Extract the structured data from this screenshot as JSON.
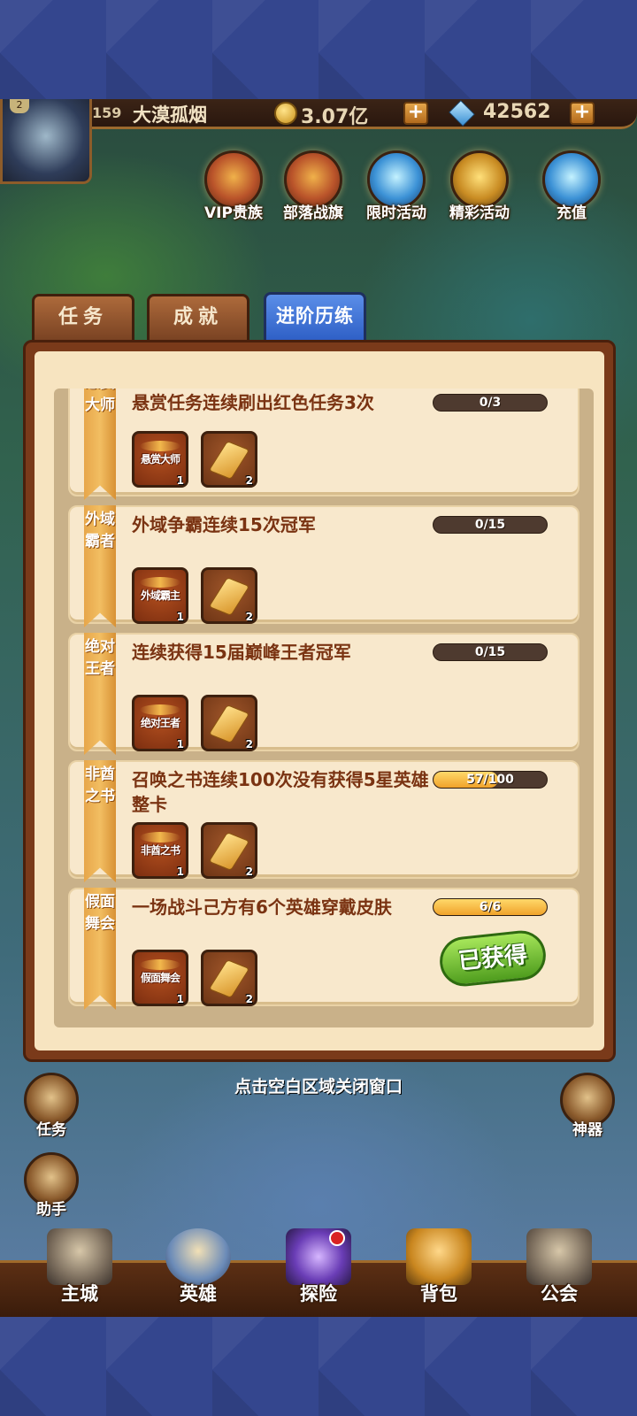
{
  "player": {
    "level": "159",
    "avatar_level": "2",
    "name": "大漠孤烟",
    "gold": "3.07亿",
    "gems": "42562"
  },
  "top_features": [
    {
      "label": "VIP贵族",
      "icon": "crown-icon"
    },
    {
      "label": "部落战旗",
      "icon": "banner-icon"
    },
    {
      "label": "限时活动",
      "icon": "compass-icon"
    },
    {
      "label": "精彩活动",
      "icon": "chest-icon"
    },
    {
      "label": "充值",
      "icon": "diamond-icon"
    }
  ],
  "tabs": [
    {
      "label": "任务",
      "active": false
    },
    {
      "label": "成就",
      "active": false
    },
    {
      "label": "进阶历练",
      "active": true
    }
  ],
  "tasks": [
    {
      "ribbon": "悬赏大师",
      "title": "悬赏任务连续刷出红色任务3次",
      "progress_text": "0/3",
      "progress": 0,
      "badge": "悬赏大师",
      "badge_count": "1",
      "scroll_count": "2",
      "obtained": false
    },
    {
      "ribbon": "外域霸者",
      "title": "外域争霸连续15次冠军",
      "progress_text": "0/15",
      "progress": 0,
      "badge": "外域霸主",
      "badge_count": "1",
      "scroll_count": "2",
      "obtained": false
    },
    {
      "ribbon": "绝对王者",
      "title": "连续获得15届巅峰王者冠军",
      "progress_text": "0/15",
      "progress": 0,
      "badge": "绝对王者",
      "badge_count": "1",
      "scroll_count": "2",
      "obtained": false
    },
    {
      "ribbon": "非酋之书",
      "title": "召唤之书连续100次没有获得5星英雄整卡",
      "progress_text": "57/100",
      "progress": 0.57,
      "badge": "非酋之书",
      "badge_count": "1",
      "scroll_count": "2",
      "obtained": false
    },
    {
      "ribbon": "假面舞会",
      "title": "一场战斗己方有6个英雄穿戴皮肤",
      "progress_text": "6/6",
      "progress": 1,
      "badge": "假面舞会",
      "badge_count": "1",
      "scroll_count": "2",
      "obtained": true,
      "obtained_label": "已获得"
    }
  ],
  "close_hint": "点击空白区域关闭窗口",
  "side_buttons": [
    {
      "label": "任务",
      "icon": "quest-scroll-icon"
    },
    {
      "label": "助手",
      "icon": "gift-icon"
    },
    {
      "label": "神器",
      "icon": "artifact-icon"
    }
  ],
  "bottom_nav": [
    {
      "label": "主城",
      "icon": "castle-icon"
    },
    {
      "label": "英雄",
      "icon": "hero-icon"
    },
    {
      "label": "探险",
      "icon": "portal-icon"
    },
    {
      "label": "背包",
      "icon": "backpack-icon"
    },
    {
      "label": "公会",
      "icon": "guild-tower-icon"
    }
  ],
  "colors": {
    "dialog_border": "#7a3a1a",
    "card_bg": "#f8e8cc",
    "active_tab": "#2d5ec5",
    "progress_fill": "#f0a22a",
    "obtained_green": "#4f9d1e"
  }
}
